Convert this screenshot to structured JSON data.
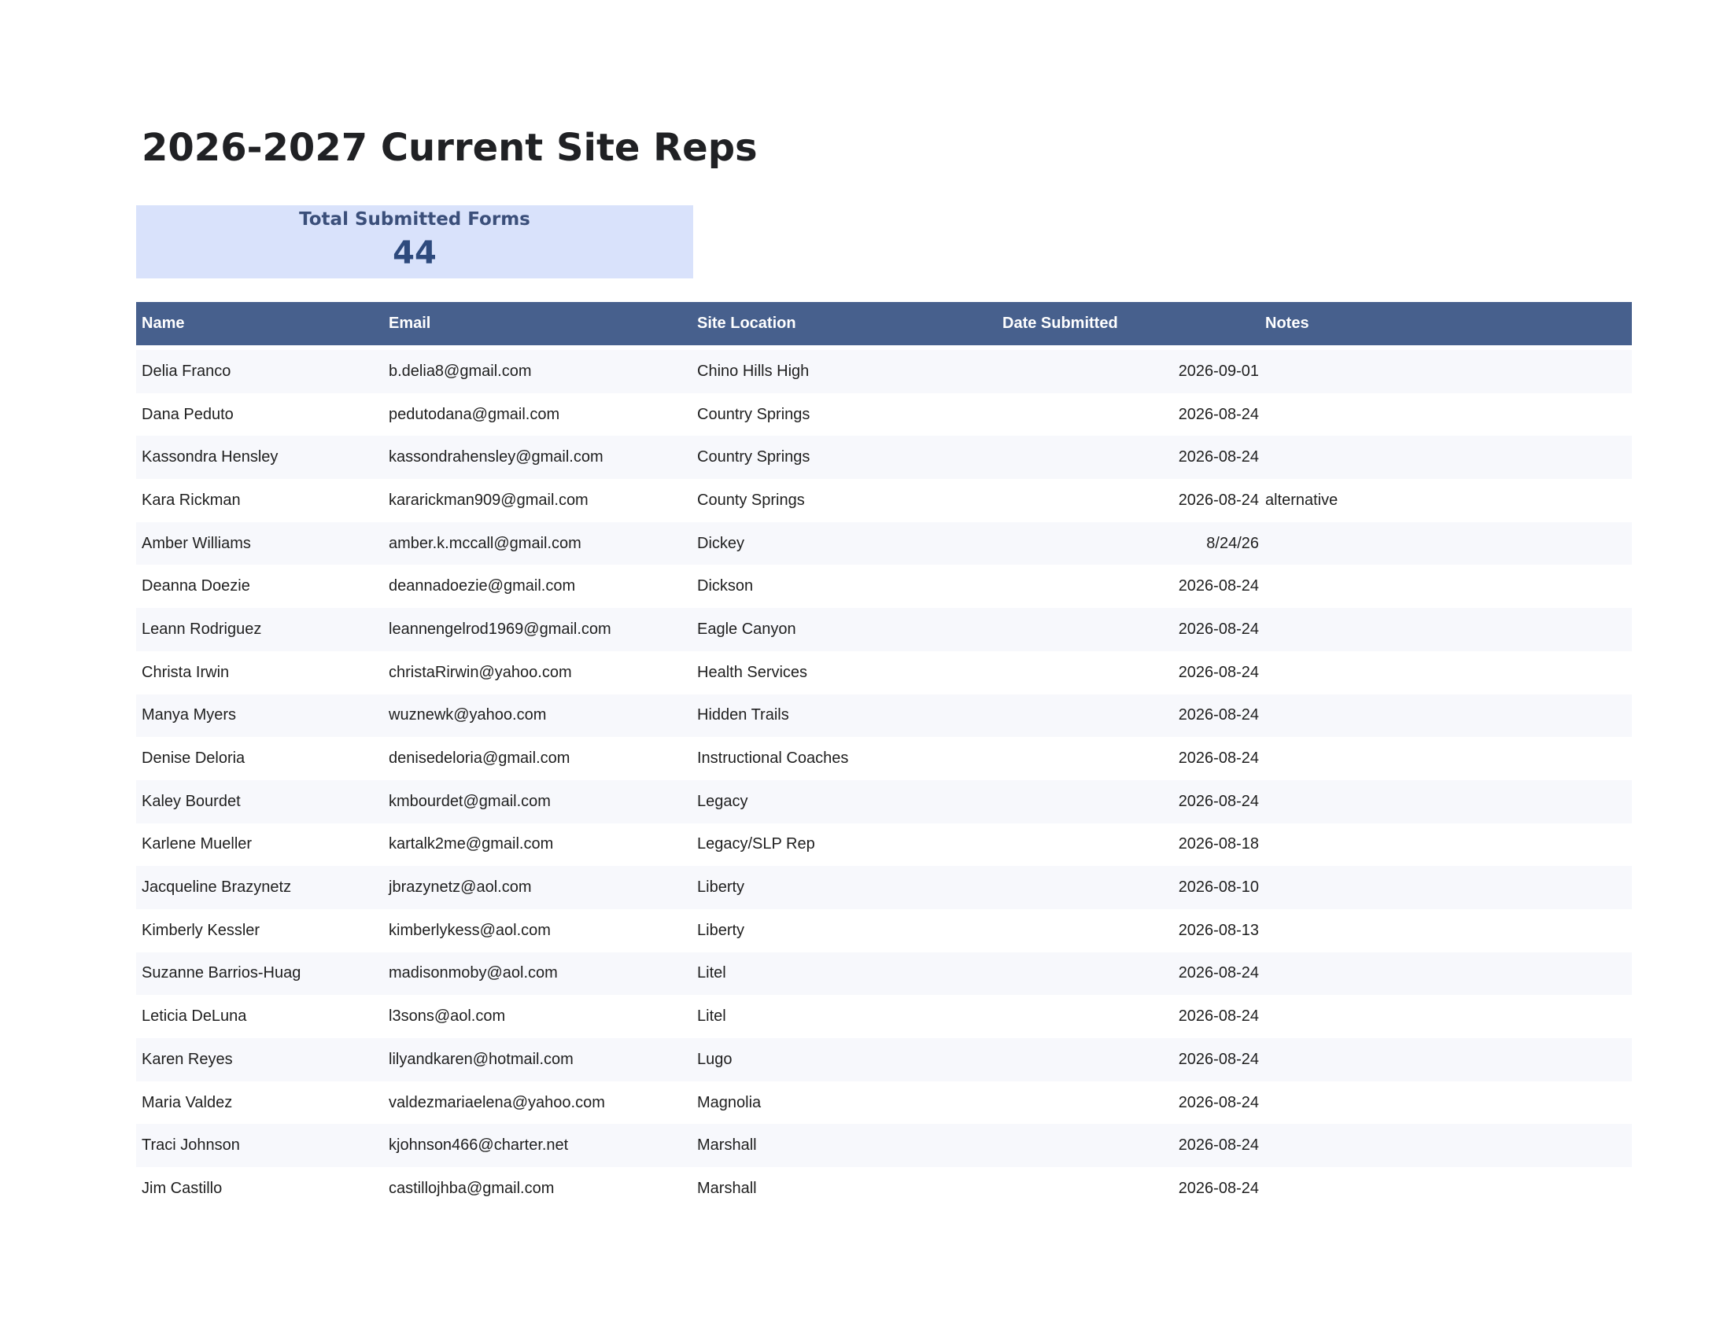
{
  "title": "2026-2027 Current Site Reps",
  "summary": {
    "label": "Total Submitted Forms",
    "value": "44"
  },
  "table": {
    "headers": {
      "name": "Name",
      "email": "Email",
      "site": "Site Location",
      "date": "Date Submitted",
      "notes": "Notes"
    },
    "rows": [
      {
        "name": "Delia Franco",
        "email": "b.delia8@gmail.com",
        "site": "Chino Hills High",
        "date": "2026-09-01",
        "notes": ""
      },
      {
        "name": "Dana Peduto",
        "email": "pedutodana@gmail.com",
        "site": "Country Springs",
        "date": "2026-08-24",
        "notes": ""
      },
      {
        "name": "Kassondra Hensley",
        "email": "kassondrahensley@gmail.com",
        "site": "Country Springs",
        "date": "2026-08-24",
        "notes": ""
      },
      {
        "name": "Kara Rickman",
        "email": "kararickman909@gmail.com",
        "site": "County Springs",
        "date": "2026-08-24",
        "notes": "alternative"
      },
      {
        "name": "Amber Williams",
        "email": "amber.k.mccall@gmail.com",
        "site": "Dickey",
        "date": "8/24/26",
        "notes": ""
      },
      {
        "name": "Deanna Doezie",
        "email": "deannadoezie@gmail.com",
        "site": "Dickson",
        "date": "2026-08-24",
        "notes": ""
      },
      {
        "name": "Leann Rodriguez",
        "email": "leannengelrod1969@gmail.com",
        "site": "Eagle Canyon",
        "date": "2026-08-24",
        "notes": ""
      },
      {
        "name": "Christa Irwin",
        "email": "christaRirwin@yahoo.com",
        "site": "Health Services",
        "date": "2026-08-24",
        "notes": ""
      },
      {
        "name": "Manya Myers",
        "email": "wuznewk@yahoo.com",
        "site": "Hidden Trails",
        "date": "2026-08-24",
        "notes": ""
      },
      {
        "name": "Denise Deloria",
        "email": "denisedeloria@gmail.com",
        "site": "Instructional Coaches",
        "date": "2026-08-24",
        "notes": ""
      },
      {
        "name": "Kaley Bourdet",
        "email": "kmbourdet@gmail.com",
        "site": "Legacy",
        "date": "2026-08-24",
        "notes": ""
      },
      {
        "name": "Karlene Mueller",
        "email": "kartalk2me@gmail.com",
        "site": "Legacy/SLP Rep",
        "date": "2026-08-18",
        "notes": ""
      },
      {
        "name": "Jacqueline Brazynetz",
        "email": "jbrazynetz@aol.com",
        "site": "Liberty",
        "date": "2026-08-10",
        "notes": ""
      },
      {
        "name": "Kimberly Kessler",
        "email": "kimberlykess@aol.com",
        "site": "Liberty",
        "date": "2026-08-13",
        "notes": ""
      },
      {
        "name": "Suzanne Barrios-Huag",
        "email": "madisonmoby@aol.com",
        "site": "Litel",
        "date": "2026-08-24",
        "notes": ""
      },
      {
        "name": "Leticia DeLuna",
        "email": "l3sons@aol.com",
        "site": "Litel",
        "date": "2026-08-24",
        "notes": ""
      },
      {
        "name": "Karen Reyes",
        "email": "lilyandkaren@hotmail.com",
        "site": "Lugo",
        "date": "2026-08-24",
        "notes": ""
      },
      {
        "name": "Maria Valdez",
        "email": "valdezmariaelena@yahoo.com",
        "site": "Magnolia",
        "date": "2026-08-24",
        "notes": ""
      },
      {
        "name": "Traci Johnson",
        "email": "kjohnson466@charter.net",
        "site": "Marshall",
        "date": "2026-08-24",
        "notes": ""
      },
      {
        "name": "Jim Castillo",
        "email": "castillojhba@gmail.com",
        "site": "Marshall",
        "date": "2026-08-24",
        "notes": ""
      }
    ]
  }
}
